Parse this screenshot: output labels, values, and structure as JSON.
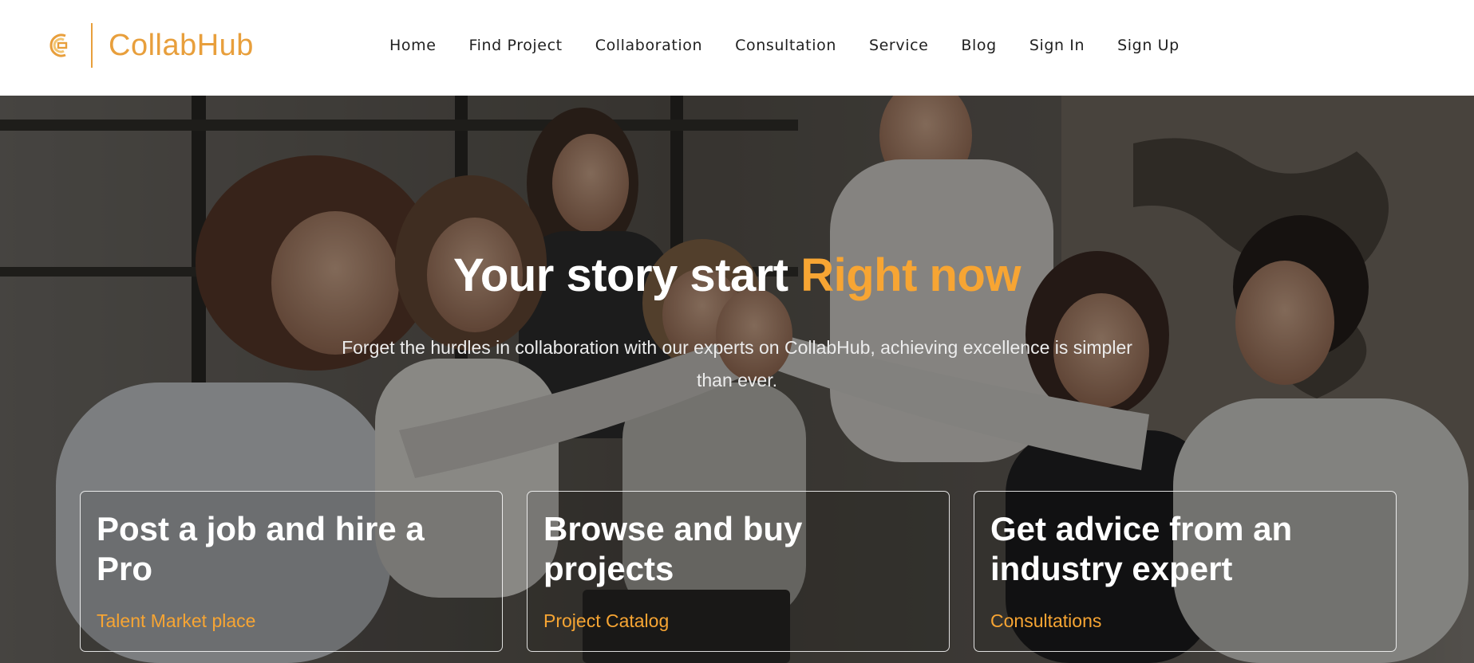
{
  "header": {
    "brand": "CollabHub",
    "nav": [
      {
        "label": "Home"
      },
      {
        "label": "Find Project"
      },
      {
        "label": "Collaboration"
      },
      {
        "label": "Consultation"
      },
      {
        "label": "Service"
      },
      {
        "label": "Blog"
      },
      {
        "label": "Sign In"
      },
      {
        "label": "Sign Up"
      }
    ]
  },
  "hero": {
    "title_main": "Your story start ",
    "title_accent": "Right now",
    "subtitle": "Forget the hurdles in collaboration with our experts on CollabHub, achieving excellence is simpler than ever.",
    "cards": [
      {
        "title": "Post a job and hire a Pro",
        "link": "Talent Market place"
      },
      {
        "title": "Browse and buy projects",
        "link": "Project Catalog"
      },
      {
        "title": "Get advice from an industry expert",
        "link": "Consultations"
      }
    ]
  },
  "colors": {
    "brand": "#e89f3c",
    "accent": "#f7a533",
    "nav_text": "#1f1f1f"
  }
}
